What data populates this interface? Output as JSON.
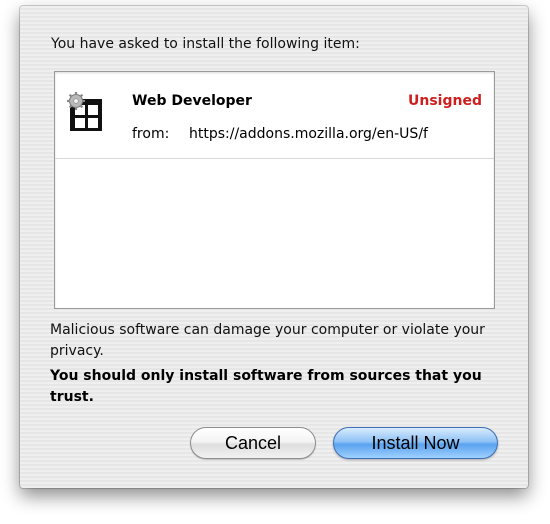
{
  "dialog": {
    "prompt": "You have asked to install the following item:",
    "item": {
      "name": "Web Developer",
      "signature_status": "Unsigned",
      "from_label": "from:",
      "url": "https://addons.mozilla.org/en-US/f",
      "icon": "web-developer-gear-grid-icon"
    },
    "warning_text": "Malicious software can damage your computer or violate your privacy.",
    "trust_text": "You should only install software from sources that you trust.",
    "buttons": {
      "cancel_label": "Cancel",
      "install_label": "Install Now"
    }
  },
  "colors": {
    "unsigned": "#cc1f1f",
    "default_button": "#5aa2ee"
  }
}
